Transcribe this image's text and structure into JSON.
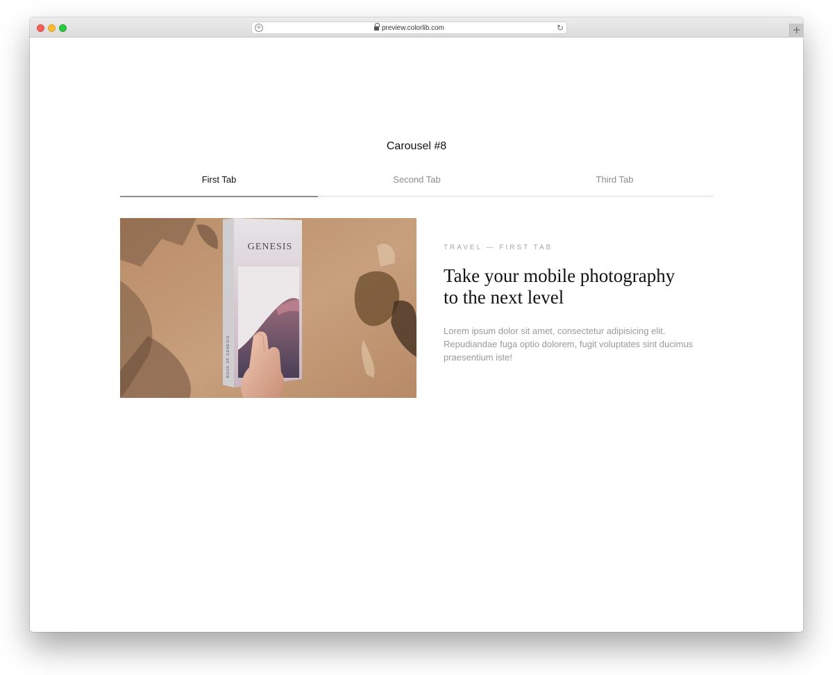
{
  "browser": {
    "url": "preview.colorlib.com",
    "new_tab_label": "+"
  },
  "page": {
    "title": "Carousel #8",
    "tabs": [
      {
        "label": "First Tab",
        "active": true
      },
      {
        "label": "Second Tab",
        "active": false
      },
      {
        "label": "Third Tab",
        "active": false
      }
    ],
    "slide": {
      "eyebrow": "TRAVEL — FIRST TAB",
      "headline_line1": "Take your mobile photography",
      "headline_line2": "to the next level",
      "body_line1": "Lorem ipsum dolor sit amet, consectetur adipisicing elit.",
      "body_line2": "Repudiandae fuga optio dolorem, fugit voluptates sint ducimus",
      "body_line3": "praesentium iste!",
      "image": {
        "book_title": "GENESIS",
        "book_spine": "BOOK OF GENESIS"
      }
    }
  },
  "colors": {
    "accent_underline": "#8e8e8e",
    "eyebrow": "#a3a8b6",
    "image_bg": "#c49a77"
  }
}
